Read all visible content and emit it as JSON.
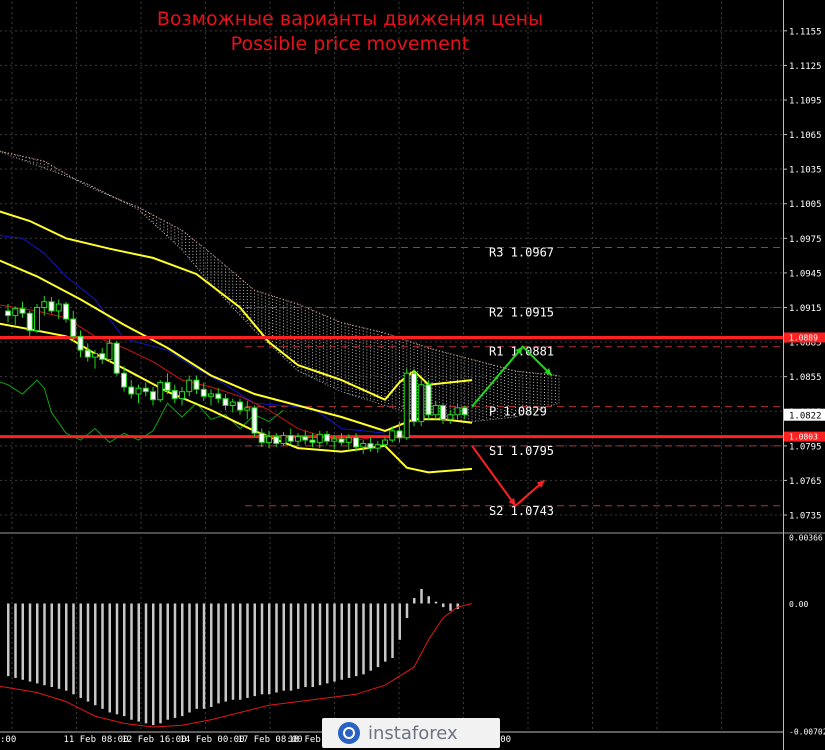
{
  "title": {
    "line1": "Возможные варианты движения цены",
    "line2": "Possible price movement"
  },
  "watermark": {
    "text": "instaforex"
  },
  "colors": {
    "background": "#000000",
    "grid": "#3a3a3a",
    "candle": "#22d81c",
    "bollinger": "#ffff2a",
    "kijun": "#1414c8",
    "tenkan": "#c81414",
    "chikou": "#13a313",
    "cloud": "#cfcfcf",
    "level_line": "#ff2020",
    "pivot_dash": "#b83030",
    "axis_text": "#ffffff",
    "arrow_up": "#22d81c",
    "arrow_down": "#ff2020",
    "histogram": "#c8c8c8",
    "signal": "#e01818"
  },
  "chart_data": [
    {
      "type": "line",
      "name": "main",
      "y_axis": {
        "min": 1.0722,
        "max": 1.118,
        "ticks": [
          "1.1155",
          "1.1125",
          "1.1095",
          "1.1065",
          "1.1035",
          "1.1005",
          "1.0975",
          "1.0945",
          "1.0915",
          "1.0885",
          "1.0855",
          "1.0825",
          "1.0795",
          "1.0765",
          "1.0735"
        ]
      },
      "x_axis": {
        "labels": [
          {
            "x": 0,
            "text": ":00"
          },
          {
            "x": 6,
            "text": "11 Feb 08:00"
          },
          {
            "x": 14,
            "text": "12 Feb 16:00"
          },
          {
            "x": 22,
            "text": "14 Feb 00:00"
          },
          {
            "x": 30,
            "text": "17 Feb 08:00"
          },
          {
            "x": 37,
            "text": "18 Feb 16:00"
          },
          {
            "x": 64,
            "text": "16:00"
          }
        ]
      },
      "current_price": {
        "label": "1.0822",
        "value": 1.0822
      },
      "price_tags": [
        {
          "label": "1.0889",
          "value": 1.0889
        },
        {
          "label": "1.0803",
          "value": 1.0803
        }
      ],
      "horizontal_levels": [
        1.0889,
        1.0803
      ],
      "pivot_levels": [
        {
          "name": "R3",
          "label": "R3  1.0967",
          "value": 1.0967
        },
        {
          "name": "R2",
          "label": "R2  1.0915",
          "value": 1.0915
        },
        {
          "name": "R1",
          "label": "R1  1.0881",
          "value": 1.0881
        },
        {
          "name": "P",
          "label": "P  1.0829",
          "value": 1.0829
        },
        {
          "name": "S1",
          "label": "S1  1.0795",
          "value": 1.0795
        },
        {
          "name": "S2",
          "label": "S2  1.0743",
          "value": 1.0743
        }
      ],
      "candles": [
        [
          1.0912,
          1.0918,
          1.0902,
          1.0908
        ],
        [
          1.0908,
          1.0916,
          1.09,
          1.0914
        ],
        [
          1.0914,
          1.092,
          1.0906,
          1.091
        ],
        [
          1.091,
          1.0912,
          1.089,
          1.0895
        ],
        [
          1.0895,
          1.0918,
          1.0893,
          1.0915
        ],
        [
          1.0915,
          1.0925,
          1.0908,
          1.092
        ],
        [
          1.092,
          1.0924,
          1.091,
          1.0912
        ],
        [
          1.0912,
          1.0922,
          1.0905,
          1.0918
        ],
        [
          1.0918,
          1.092,
          1.0902,
          1.0905
        ],
        [
          1.0905,
          1.0912,
          1.0885,
          1.089
        ],
        [
          1.089,
          1.0895,
          1.0872,
          1.0878
        ],
        [
          1.0878,
          1.0884,
          1.0868,
          1.0872
        ],
        [
          1.0872,
          1.0878,
          1.0862,
          1.0875
        ],
        [
          1.0875,
          1.088,
          1.0866,
          1.087
        ],
        [
          1.087,
          1.0888,
          1.0868,
          1.0884
        ],
        [
          1.0884,
          1.0886,
          1.0856,
          1.0858
        ],
        [
          1.0858,
          1.0864,
          1.0842,
          1.0846
        ],
        [
          1.0846,
          1.0852,
          1.0836,
          1.084
        ],
        [
          1.084,
          1.0848,
          1.0832,
          1.0845
        ],
        [
          1.0845,
          1.085,
          1.0838,
          1.0842
        ],
        [
          1.0842,
          1.0846,
          1.083,
          1.0835
        ],
        [
          1.0835,
          1.0852,
          1.0833,
          1.085
        ],
        [
          1.085,
          1.0858,
          1.084,
          1.0843
        ],
        [
          1.0843,
          1.0848,
          1.0832,
          1.0836
        ],
        [
          1.0836,
          1.0846,
          1.083,
          1.0842
        ],
        [
          1.0842,
          1.0856,
          1.0838,
          1.0852
        ],
        [
          1.0852,
          1.0856,
          1.084,
          1.0844
        ],
        [
          1.0844,
          1.085,
          1.0834,
          1.0838
        ],
        [
          1.0838,
          1.0844,
          1.083,
          1.084
        ],
        [
          1.084,
          1.0845,
          1.0832,
          1.0836
        ],
        [
          1.0836,
          1.084,
          1.0826,
          1.083
        ],
        [
          1.083,
          1.0836,
          1.0824,
          1.0833
        ],
        [
          1.0833,
          1.0836,
          1.0822,
          1.0826
        ],
        [
          1.0826,
          1.0834,
          1.0818,
          1.0828
        ],
        [
          1.0828,
          1.083,
          1.0803,
          1.0806
        ],
        [
          1.0806,
          1.081,
          1.0794,
          1.0798
        ],
        [
          1.0798,
          1.0808,
          1.0793,
          1.0803
        ],
        [
          1.0803,
          1.0806,
          1.0794,
          1.0797
        ],
        [
          1.0797,
          1.0807,
          1.0795,
          1.0804
        ],
        [
          1.0804,
          1.081,
          1.0796,
          1.0799
        ],
        [
          1.0799,
          1.0806,
          1.0795,
          1.0803
        ],
        [
          1.0803,
          1.0808,
          1.0796,
          1.08
        ],
        [
          1.08,
          1.0806,
          1.0794,
          1.0798
        ],
        [
          1.0798,
          1.0808,
          1.0793,
          1.0805
        ],
        [
          1.0805,
          1.0808,
          1.0796,
          1.0799
        ],
        [
          1.0799,
          1.0804,
          1.0792,
          1.0801
        ],
        [
          1.0801,
          1.0806,
          1.0796,
          1.0798
        ],
        [
          1.0798,
          1.0805,
          1.0792,
          1.0802
        ],
        [
          1.0802,
          1.0806,
          1.079,
          1.0794
        ],
        [
          1.0794,
          1.08,
          1.0788,
          1.0797
        ],
        [
          1.0797,
          1.0802,
          1.079,
          1.0793
        ],
        [
          1.0793,
          1.0799,
          1.0789,
          1.0796
        ],
        [
          1.0796,
          1.0802,
          1.0794,
          1.08
        ],
        [
          1.08,
          1.0812,
          1.0798,
          1.0808
        ],
        [
          1.0808,
          1.0816,
          1.0798,
          1.0802
        ],
        [
          1.0802,
          1.0862,
          1.08,
          1.0858
        ],
        [
          1.0858,
          1.0862,
          1.0812,
          1.0816
        ],
        [
          1.0816,
          1.0852,
          1.0812,
          1.0848
        ],
        [
          1.0848,
          1.0852,
          1.0818,
          1.0822
        ],
        [
          1.0822,
          1.0834,
          1.0818,
          1.083
        ],
        [
          1.083,
          1.0832,
          1.0814,
          1.0818
        ],
        [
          1.0818,
          1.0826,
          1.0814,
          1.0822
        ],
        [
          1.0822,
          1.0832,
          1.0818,
          1.0828
        ],
        [
          1.0828,
          1.083,
          1.0818,
          1.0822
        ]
      ],
      "bollinger_upper": [
        [
          -2,
          1.1
        ],
        [
          3,
          1.099
        ],
        [
          8,
          1.0975
        ],
        [
          14,
          1.0966
        ],
        [
          20,
          1.0958
        ],
        [
          26,
          1.0944
        ],
        [
          32,
          1.0915
        ],
        [
          36,
          1.0885
        ],
        [
          40,
          1.0865
        ],
        [
          46,
          1.0852
        ],
        [
          52,
          1.0835
        ],
        [
          54,
          1.085
        ],
        [
          56,
          1.086
        ],
        [
          58,
          1.0848
        ],
        [
          64,
          1.0852
        ]
      ],
      "bollinger_middle": [
        [
          -2,
          1.0958
        ],
        [
          4,
          1.0942
        ],
        [
          10,
          1.0922
        ],
        [
          16,
          1.09
        ],
        [
          22,
          1.088
        ],
        [
          28,
          1.0856
        ],
        [
          34,
          1.084
        ],
        [
          40,
          1.083
        ],
        [
          46,
          1.082
        ],
        [
          52,
          1.0808
        ],
        [
          56,
          1.0818
        ],
        [
          60,
          1.0818
        ],
        [
          64,
          1.0815
        ]
      ],
      "bollinger_lower": [
        [
          -2,
          1.0902
        ],
        [
          4,
          1.0895
        ],
        [
          8,
          1.089
        ],
        [
          12,
          1.0875
        ],
        [
          16,
          1.0862
        ],
        [
          22,
          1.0842
        ],
        [
          28,
          1.0826
        ],
        [
          34,
          1.0808
        ],
        [
          40,
          1.0793
        ],
        [
          46,
          1.079
        ],
        [
          52,
          1.0795
        ],
        [
          55,
          1.0776
        ],
        [
          58,
          1.0772
        ],
        [
          64,
          1.0775
        ]
      ],
      "kijun": [
        [
          -2,
          1.0978
        ],
        [
          2,
          1.0975
        ],
        [
          5,
          1.0962
        ],
        [
          8,
          1.0942
        ],
        [
          12,
          1.0922
        ],
        [
          16,
          1.0888
        ],
        [
          22,
          1.0878
        ],
        [
          26,
          1.0862
        ],
        [
          30,
          1.0848
        ],
        [
          34,
          1.0832
        ],
        [
          42,
          1.0828
        ],
        [
          46,
          1.081
        ],
        [
          52,
          1.0806
        ]
      ],
      "tenkan": [
        [
          -2,
          1.0918
        ],
        [
          4,
          1.0912
        ],
        [
          8,
          1.0906
        ],
        [
          12,
          1.089
        ],
        [
          16,
          1.088
        ],
        [
          20,
          1.0868
        ],
        [
          24,
          1.0852
        ],
        [
          28,
          1.0846
        ],
        [
          32,
          1.0838
        ],
        [
          36,
          1.0826
        ],
        [
          40,
          1.081
        ],
        [
          44,
          1.0802
        ],
        [
          48,
          1.08
        ],
        [
          52,
          1.0804
        ]
      ],
      "chikou": [
        [
          -2,
          1.0852
        ],
        [
          0,
          1.0848
        ],
        [
          2,
          1.084
        ],
        [
          4,
          1.0852
        ],
        [
          5,
          1.0845
        ],
        [
          6,
          1.0824
        ],
        [
          8,
          1.0806
        ],
        [
          10,
          1.08
        ],
        [
          12,
          1.081
        ],
        [
          14,
          1.0798
        ],
        [
          16,
          1.0806
        ],
        [
          18,
          1.08
        ],
        [
          20,
          1.0808
        ],
        [
          22,
          1.0832
        ],
        [
          24,
          1.082
        ],
        [
          26,
          1.0832
        ],
        [
          28,
          1.0818
        ],
        [
          30,
          1.0822
        ],
        [
          32,
          1.081
        ],
        [
          34,
          1.0822
        ],
        [
          36,
          1.0816
        ],
        [
          38,
          1.0826
        ]
      ],
      "cloud_top": [
        [
          -2,
          1.1052
        ],
        [
          5,
          1.1042
        ],
        [
          11,
          1.102
        ],
        [
          18,
          1.1002
        ],
        [
          24,
          1.0982
        ],
        [
          28,
          1.0962
        ],
        [
          34,
          1.093
        ],
        [
          40,
          1.0918
        ],
        [
          46,
          1.0902
        ],
        [
          52,
          1.0893
        ],
        [
          58,
          1.088
        ],
        [
          64,
          1.087
        ],
        [
          70,
          1.086
        ],
        [
          76,
          1.0856
        ]
      ],
      "cloud_bottom": [
        [
          -2,
          1.1052
        ],
        [
          5,
          1.1036
        ],
        [
          11,
          1.1022
        ],
        [
          18,
          1.1
        ],
        [
          24,
          1.0965
        ],
        [
          28,
          1.0935
        ],
        [
          34,
          1.0895
        ],
        [
          40,
          1.086
        ],
        [
          46,
          1.0842
        ],
        [
          52,
          1.083
        ],
        [
          58,
          1.0818
        ],
        [
          64,
          1.0816
        ],
        [
          70,
          1.082
        ],
        [
          76,
          1.0832
        ]
      ],
      "arrows": [
        {
          "dir": "up",
          "from": [
            64,
            1.0829
          ],
          "mid": [
            71,
            1.0881
          ],
          "to": [
            75,
            1.0856
          ]
        },
        {
          "dir": "down",
          "from": [
            64,
            1.0795
          ],
          "mid": [
            70,
            1.0743
          ],
          "to": [
            74,
            1.0765
          ]
        }
      ]
    },
    {
      "type": "bar",
      "name": "oscillator",
      "y_axis": {
        "min": -0.00702,
        "max": 0.00366,
        "ticks": [
          "0.00366",
          "0.00",
          "-0.00702"
        ]
      },
      "histogram": [
        -0.004,
        -0.0041,
        -0.0042,
        -0.0043,
        -0.0044,
        -0.0045,
        -0.0046,
        -0.0047,
        -0.0048,
        -0.005,
        -0.0052,
        -0.0054,
        -0.0056,
        -0.0058,
        -0.006,
        -0.0061,
        -0.0062,
        -0.0064,
        -0.0065,
        -0.0066,
        -0.0067,
        -0.0066,
        -0.0064,
        -0.0063,
        -0.0062,
        -0.006,
        -0.0058,
        -0.0058,
        -0.0057,
        -0.0055,
        -0.0054,
        -0.0053,
        -0.0053,
        -0.0052,
        -0.0051,
        -0.005,
        -0.005,
        -0.0049,
        -0.0048,
        -0.0048,
        -0.0047,
        -0.0046,
        -0.0046,
        -0.0045,
        -0.0044,
        -0.0043,
        -0.0042,
        -0.0041,
        -0.004,
        -0.0039,
        -0.0037,
        -0.0035,
        -0.0032,
        -0.003,
        -0.002,
        -0.0008,
        0.0003,
        0.0008,
        0.0004,
        0.0001,
        -0.0002,
        -0.0004,
        -0.0003
      ],
      "signal": [
        [
          -2,
          -0.0045
        ],
        [
          4,
          -0.0049
        ],
        [
          8,
          -0.0054
        ],
        [
          12,
          -0.0062
        ],
        [
          16,
          -0.0066
        ],
        [
          20,
          -0.0068
        ],
        [
          24,
          -0.0067
        ],
        [
          28,
          -0.0064
        ],
        [
          32,
          -0.006
        ],
        [
          36,
          -0.0056
        ],
        [
          40,
          -0.0054
        ],
        [
          44,
          -0.0052
        ],
        [
          48,
          -0.005
        ],
        [
          52,
          -0.0045
        ],
        [
          56,
          -0.0035
        ],
        [
          58,
          -0.002
        ],
        [
          60,
          -0.0008
        ],
        [
          62,
          -0.0002
        ],
        [
          64,
          0.0
        ]
      ]
    }
  ]
}
